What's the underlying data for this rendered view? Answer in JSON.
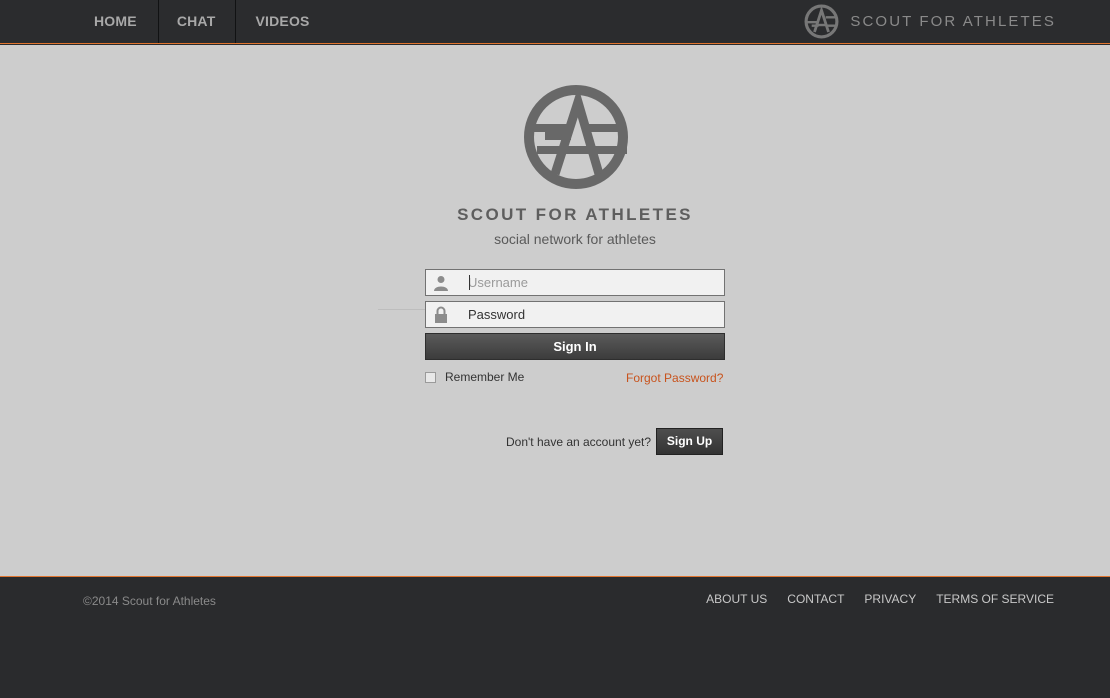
{
  "nav": {
    "items": [
      {
        "label": "HOME"
      },
      {
        "label": "CHAT"
      },
      {
        "label": "VIDEOS"
      }
    ]
  },
  "brand": {
    "name": "SCOUT FOR ATHLETES"
  },
  "hero": {
    "title": "SCOUT FOR ATHLETES",
    "subtitle": "social network for athletes"
  },
  "login": {
    "username_placeholder": "Username",
    "username_value": "",
    "password_placeholder": "Password",
    "signin_label": "Sign In",
    "remember_label": "Remember Me",
    "remember_checked": false,
    "forgot_label": "Forgot Password?",
    "signup_prompt": "Don't have an account yet?",
    "signup_label": "Sign Up"
  },
  "footer": {
    "copyright": "©2014 Scout for Athletes",
    "links": [
      {
        "label": "ABOUT US"
      },
      {
        "label": "CONTACT"
      },
      {
        "label": "PRIVACY"
      },
      {
        "label": "TERMS OF SERVICE"
      }
    ]
  },
  "colors": {
    "accent": "#e0752f",
    "link": "#c8531d",
    "header_bg": "#2b2c2e",
    "main_bg": "#cdcdcd",
    "logo_gray": "#686868"
  },
  "icons": {
    "username": "user-icon",
    "password": "lock-icon",
    "logo": "sa-logo"
  }
}
